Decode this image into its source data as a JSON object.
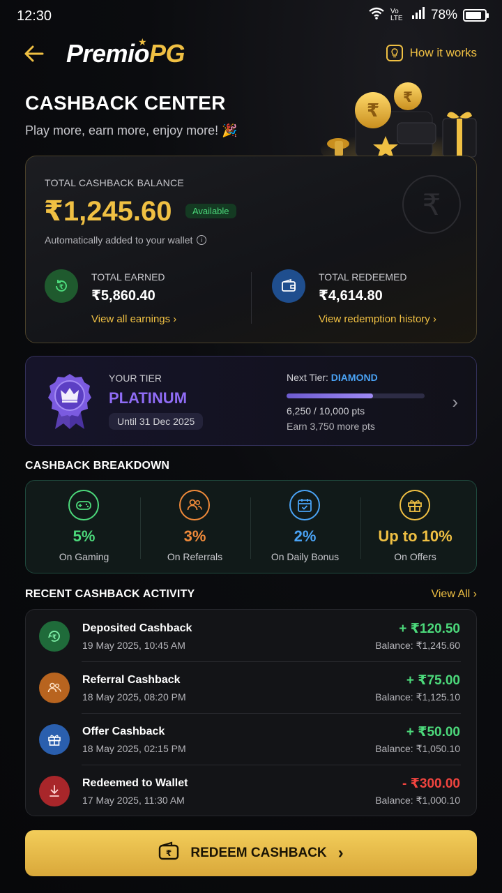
{
  "status_bar": {
    "time": "12:30",
    "network": "Vo LTE",
    "battery": "78%"
  },
  "header": {
    "logo_part1": "Premio",
    "logo_part2": "PG",
    "how_it_works": "How it works"
  },
  "page": {
    "title": "CASHBACK CENTER",
    "subtitle": "Play more, earn more, enjoy more! 🎉"
  },
  "balance": {
    "label": "TOTAL CASHBACK BALANCE",
    "amount": "₹1,245.60",
    "badge": "Available",
    "note": "Automatically added to your wallet",
    "earned": {
      "label": "TOTAL EARNED",
      "value": "₹5,860.40",
      "link": "View all earnings ›"
    },
    "redeemed": {
      "label": "TOTAL REDEEMED",
      "value": "₹4,614.80",
      "link": "View redemption history ›"
    }
  },
  "tier": {
    "label": "YOUR TIER",
    "name": "PLATINUM",
    "until": "Until 31 Dec 2025",
    "next_label": "Next Tier: ",
    "next_name": "DIAMOND",
    "progress_fraction": 0.625,
    "progress_text": "6,250 / 10,000 pts",
    "earn_more": "Earn 3,750 more pts"
  },
  "breakdown": {
    "title": "CASHBACK BREAKDOWN",
    "items": [
      {
        "value": "5%",
        "label": "On Gaming",
        "color": "#4cd97b",
        "icon": "gamepad-icon"
      },
      {
        "value": "3%",
        "label": "On Referrals",
        "color": "#f08a3a",
        "icon": "users-icon"
      },
      {
        "value": "2%",
        "label": "On Daily Bonus",
        "color": "#4aa3f5",
        "icon": "calendar-check-icon"
      },
      {
        "value": "Up to 10%",
        "label": "On Offers",
        "color": "#f0c043",
        "icon": "gift-icon"
      }
    ]
  },
  "activity": {
    "title": "RECENT CASHBACK ACTIVITY",
    "view_all": "View All ›",
    "rows": [
      {
        "title": "Deposited Cashback",
        "date": "19 May 2025, 10:45 AM",
        "amount": "+ ₹120.50",
        "balance": "Balance: ₹1,245.60",
        "amount_color": "#4cd97b",
        "icon_bg": "#1f6b3a",
        "icon": "deposit-cashback-icon"
      },
      {
        "title": "Referral Cashback",
        "date": "18 May 2025, 08:20 PM",
        "amount": "+ ₹75.00",
        "balance": "Balance: ₹1,125.10",
        "amount_color": "#4cd97b",
        "icon_bg": "#b8641f",
        "icon": "users-icon"
      },
      {
        "title": "Offer Cashback",
        "date": "18 May 2025, 02:15 PM",
        "amount": "+ ₹50.00",
        "balance": "Balance: ₹1,050.10",
        "amount_color": "#4cd97b",
        "icon_bg": "#2a5fae",
        "icon": "gift-icon"
      },
      {
        "title": "Redeemed to Wallet",
        "date": "17 May 2025, 11:30 AM",
        "amount": "- ₹300.00",
        "balance": "Balance: ₹1,000.10",
        "amount_color": "#f0443f",
        "icon_bg": "#a8262a",
        "icon": "download-icon"
      }
    ]
  },
  "redeem_button": {
    "label": "REDEEM CASHBACK"
  },
  "colors": {
    "accent_gold": "#f0c043",
    "positive": "#4cd97b",
    "negative": "#f0443f",
    "tier_purple": "#8f6cf5",
    "diamond_blue": "#4aa3f5"
  }
}
